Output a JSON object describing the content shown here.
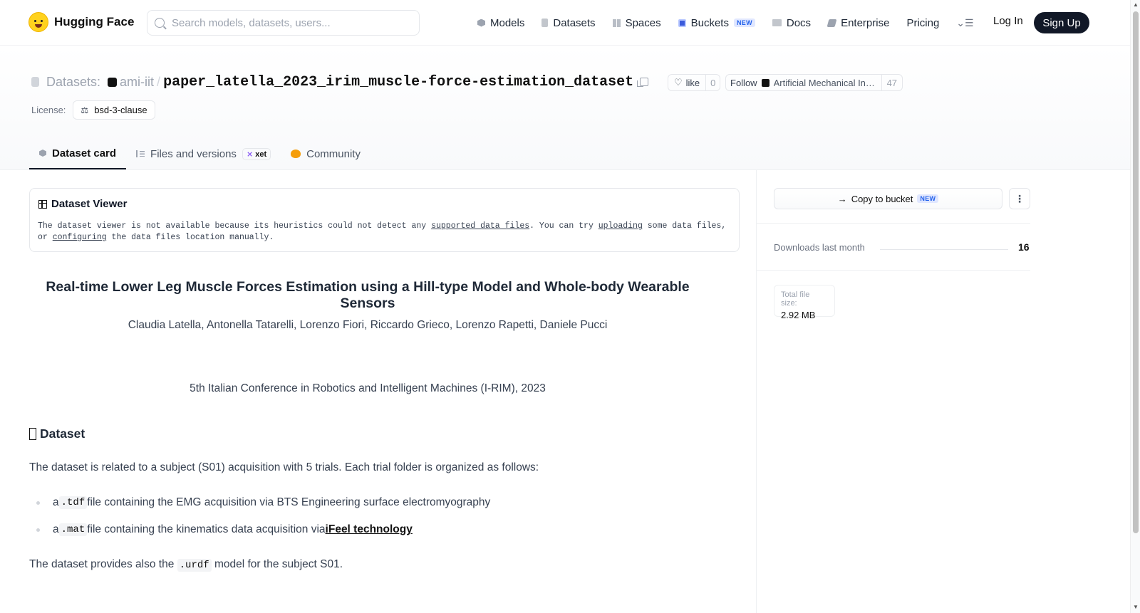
{
  "nav": {
    "brand": "Hugging Face",
    "search_placeholder": "Search models, datasets, users...",
    "items": [
      {
        "label": "Models",
        "icon": "models-icon"
      },
      {
        "label": "Datasets",
        "icon": "datasets-icon"
      },
      {
        "label": "Spaces",
        "icon": "spaces-icon"
      },
      {
        "label": "Buckets",
        "icon": "buckets-icon",
        "badge": "NEW"
      },
      {
        "label": "Docs",
        "icon": "docs-icon"
      },
      {
        "label": "Enterprise",
        "icon": "enterprise-icon"
      },
      {
        "label": "Pricing"
      }
    ],
    "login": "Log In",
    "signup": "Sign Up"
  },
  "header": {
    "section": "Datasets:",
    "org": "ami-iit",
    "slash": "/",
    "name": "paper_latella_2023_irim_muscle-force-estimation_dataset",
    "like_label": "like",
    "like_count": "0",
    "follow_label": "Follow",
    "follow_org": "Artificial Mechanical Intelligence",
    "follow_count": "47",
    "license_label": "License:",
    "license": "bsd-3-clause"
  },
  "tabs": [
    {
      "label": "Dataset card",
      "active": true
    },
    {
      "label": "Files and versions",
      "chip": "xet"
    },
    {
      "label": "Community"
    }
  ],
  "viewer": {
    "title": "Dataset Viewer",
    "text_1": "The dataset viewer is not available because its heuristics could not detect any ",
    "link_1": "supported data files",
    "text_2": ". You can try ",
    "link_2": "uploading",
    "text_3": " some data files, or ",
    "link_3": "configuring",
    "text_4": " the data files location manually."
  },
  "card": {
    "title": "Real-time Lower Leg Muscle Forces Estimation using a Hill-type Model and Whole-body Wearable Sensors",
    "authors": "Claudia Latella, Antonella Tatarelli, Lorenzo Fiori, Riccardo Grieco, Lorenzo Rapetti, Daniele Pucci",
    "venue": "5th Italian Conference in Robotics and Intelligent Machines (I-RIM), 2023",
    "section_heading": "Dataset",
    "intro": "The dataset is related to a subject (S01) acquisition with 5 trials. Each trial folder is organized as follows:",
    "bullets": [
      {
        "pre": "a ",
        "code": ".tdf",
        "post": " file containing the EMG acquisition via BTS Engineering surface electromyography"
      },
      {
        "pre": "a ",
        "code": ".mat",
        "post": " file containing the kinematics data acquisition via ",
        "link": "iFeel technology"
      }
    ],
    "outro_pre": "The dataset provides also the ",
    "outro_code": ".urdf",
    "outro_post": " model for the subject S01."
  },
  "sidebar": {
    "copy_bucket": "Copy to bucket",
    "copy_badge": "NEW",
    "downloads_label": "Downloads last month",
    "downloads_value": "16",
    "size_label": "Total file size:",
    "size_value": "2.92 MB"
  }
}
